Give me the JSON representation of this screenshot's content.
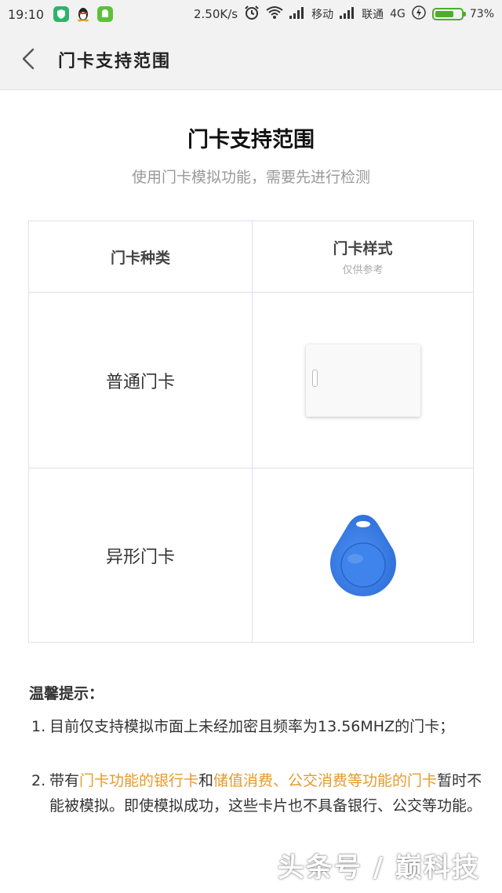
{
  "status_bar": {
    "time": "19:10",
    "speed": "2.50K/s",
    "carrier1": "移动",
    "carrier2": "联通",
    "network": "4G",
    "battery_percent": "73%",
    "battery_level": 0.73,
    "app_icons": [
      "shield-icon",
      "qq-penguin-icon",
      "android-icon"
    ],
    "accent_color": "#4caf2a"
  },
  "nav": {
    "title": "门卡支持范围",
    "back_icon": "chevron-left-icon"
  },
  "main": {
    "heading": "门卡支持范围",
    "subheading": "使用门卡模拟功能，需要先进行检测"
  },
  "table": {
    "col_type": "门卡种类",
    "col_style": "门卡样式",
    "col_style_note": "仅供参考",
    "rows": [
      {
        "type": "普通门卡",
        "image": "white-rectangular-card"
      },
      {
        "type": "异形门卡",
        "image": "blue-teardrop-key-fob"
      }
    ]
  },
  "tips": {
    "title": "温馨提示：",
    "items": [
      {
        "num": "1.",
        "text": "目前仅支持模拟市面上未经加密且频率为13.56MHZ的门卡；"
      },
      {
        "num": "2.",
        "pre": "带有",
        "hl1": "门卡功能的银行卡",
        "mid": "和",
        "hl2": "储值消费、公交消费等功能的门卡",
        "post": "暂时不能被模拟。即使模拟成功，这些卡片也不具备银行、公交等功能。"
      }
    ],
    "highlight_color": "#e69a2a"
  },
  "watermark": "头条号 / 巅科技"
}
